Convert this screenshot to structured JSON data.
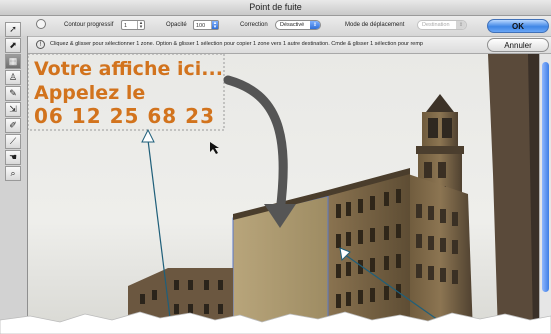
{
  "window": {
    "title": "Point de fuite"
  },
  "options": {
    "contour_label": "Contour progressif",
    "contour_value": "1",
    "opacity_label": "Opacité",
    "opacity_value": "100",
    "correction_label": "Correction",
    "correction_value": "Désactivé",
    "mode_label": "Mode de déplacement",
    "mode_value": "Destination"
  },
  "tip": {
    "text": "Cliquez & glisser pour sélectionner 1 zone. Option & glisser 1 sélection pour copier 1 zone vers 1 autre destination. Cmde & glisser 1 sélection pour remp"
  },
  "buttons": {
    "ok": "OK",
    "cancel": "Annuler"
  },
  "tools": [
    "edit-plane",
    "create-plane",
    "marquee",
    "stamp",
    "brush",
    "transform",
    "eyedropper",
    "measure",
    "hand",
    "zoom"
  ],
  "overlay": {
    "line1": "Votre affiche ici...",
    "line2": "Appelez le",
    "line3": "06 12 25 68 23"
  },
  "colors": {
    "accent": "#3f7ee4",
    "overlay_text": "#d2731d",
    "arrow": "#555555",
    "callout": "#1f5f7a"
  }
}
